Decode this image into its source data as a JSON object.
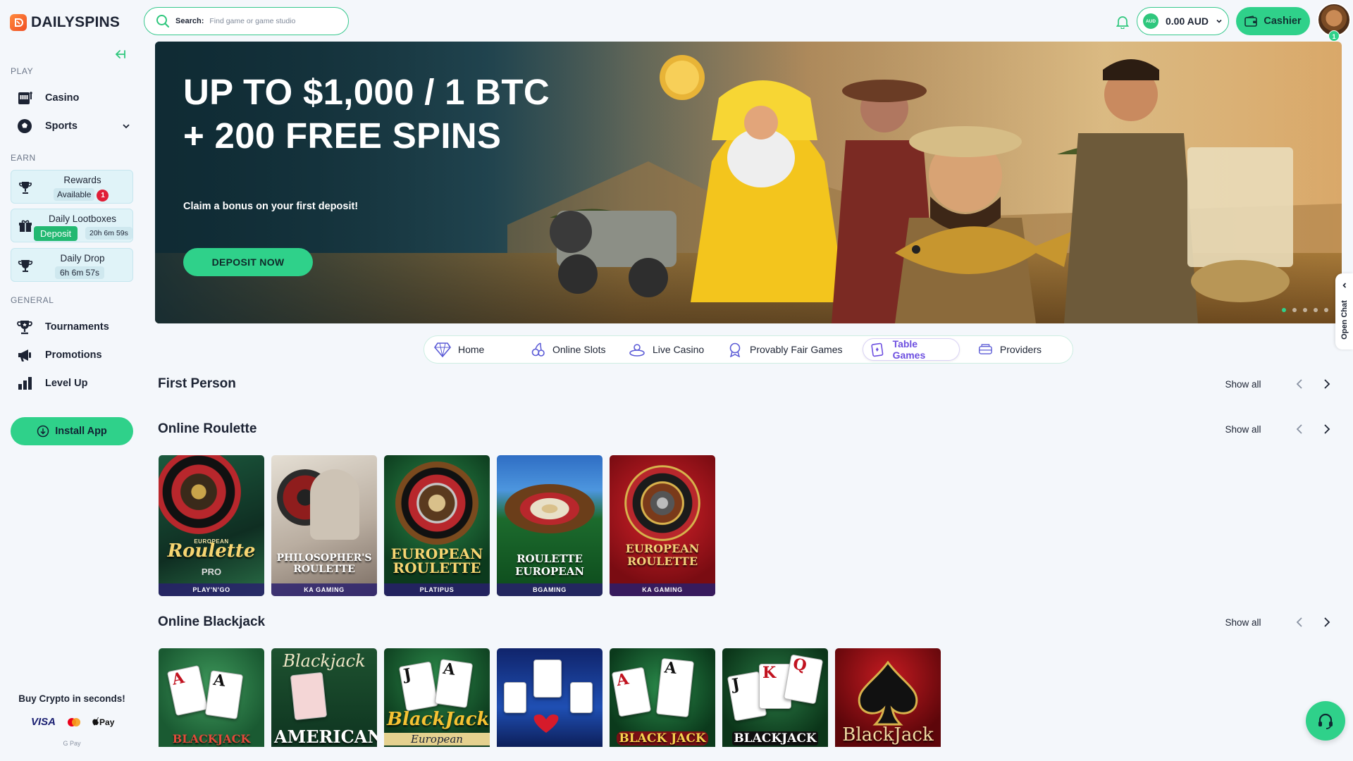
{
  "brand": {
    "name": "DAILYSPINS"
  },
  "sidebar": {
    "play_label": "PLAY",
    "play_items": [
      {
        "label": "Casino"
      },
      {
        "label": "Sports"
      }
    ],
    "earn_label": "EARN",
    "earn_cards": [
      {
        "title": "Rewards",
        "sub": "Available",
        "badge": "1"
      },
      {
        "title": "Daily Lootboxes",
        "sub": "Deposit",
        "timer": "20h 6m 59s"
      },
      {
        "title": "Daily Drop",
        "timer": "6h 6m 57s"
      }
    ],
    "general_label": "GENERAL",
    "general_items": [
      {
        "label": "Tournaments"
      },
      {
        "label": "Promotions"
      },
      {
        "label": "Level Up"
      }
    ],
    "install_label": "Install App",
    "crypto_title": "Buy Crypto in seconds!",
    "payments": {
      "visa": "VISA",
      "applepay": "Pay",
      "gpay": "G Pay"
    }
  },
  "search": {
    "label": "Search:",
    "placeholder": "Find game or game studio"
  },
  "header": {
    "currency_code": "AUD",
    "balance": "0.00 AUD",
    "cashier_label": "Cashier",
    "avatar_badge": "1"
  },
  "hero": {
    "line1": "UP TO $1,000 / 1 BTC",
    "line2": "+ 200 FREE SPINS",
    "subtitle": "Claim a bonus on your first deposit!",
    "cta": "DEPOSIT NOW",
    "slides_total": 5,
    "active_slide": 1
  },
  "chat": {
    "open_label": "Open Chat"
  },
  "categories": [
    {
      "label": "Home",
      "icon": "diamond-icon"
    },
    {
      "label": "Online Slots",
      "icon": "cherries-icon"
    },
    {
      "label": "Live Casino",
      "icon": "live-dealer-icon"
    },
    {
      "label": "Provably Fair Games",
      "icon": "badge-icon"
    },
    {
      "label": "Table Games",
      "icon": "cards-icon",
      "active": true
    },
    {
      "label": "Providers",
      "icon": "providers-icon"
    }
  ],
  "sections": {
    "first_person": {
      "title": "First Person",
      "show_all": "Show all"
    },
    "roulette": {
      "title": "Online Roulette",
      "show_all": "Show all",
      "games": [
        {
          "top": "EUROPEAN",
          "name": "Roulette",
          "sub": "PRO",
          "provider": "PLAY'N'GO"
        },
        {
          "name": "PHILOSOPHER'S ROULETTE",
          "provider": "KA GAMING"
        },
        {
          "name": "EUROPEAN ROULETTE",
          "provider": "PLATIPUS"
        },
        {
          "name": "ROULETTE EUROPEAN",
          "provider": "BGAMING"
        },
        {
          "name": "EUROPEAN ROULETTE",
          "provider": "KA GAMING"
        }
      ]
    },
    "blackjack": {
      "title": "Online Blackjack",
      "show_all": "Show all",
      "games": [
        {
          "name": "BLACKJACK"
        },
        {
          "top": "Blackjack",
          "name": "AMERICAN"
        },
        {
          "name": "BlackJack",
          "sub": "European"
        },
        {
          "name": ""
        },
        {
          "name": "BLACK JACK"
        },
        {
          "name": "BLACKJACK"
        },
        {
          "name": "BlackJack"
        }
      ]
    }
  },
  "colors": {
    "accent": "#2fd18a",
    "active_tab": "#6d4fe0",
    "alert": "#e01e37"
  }
}
